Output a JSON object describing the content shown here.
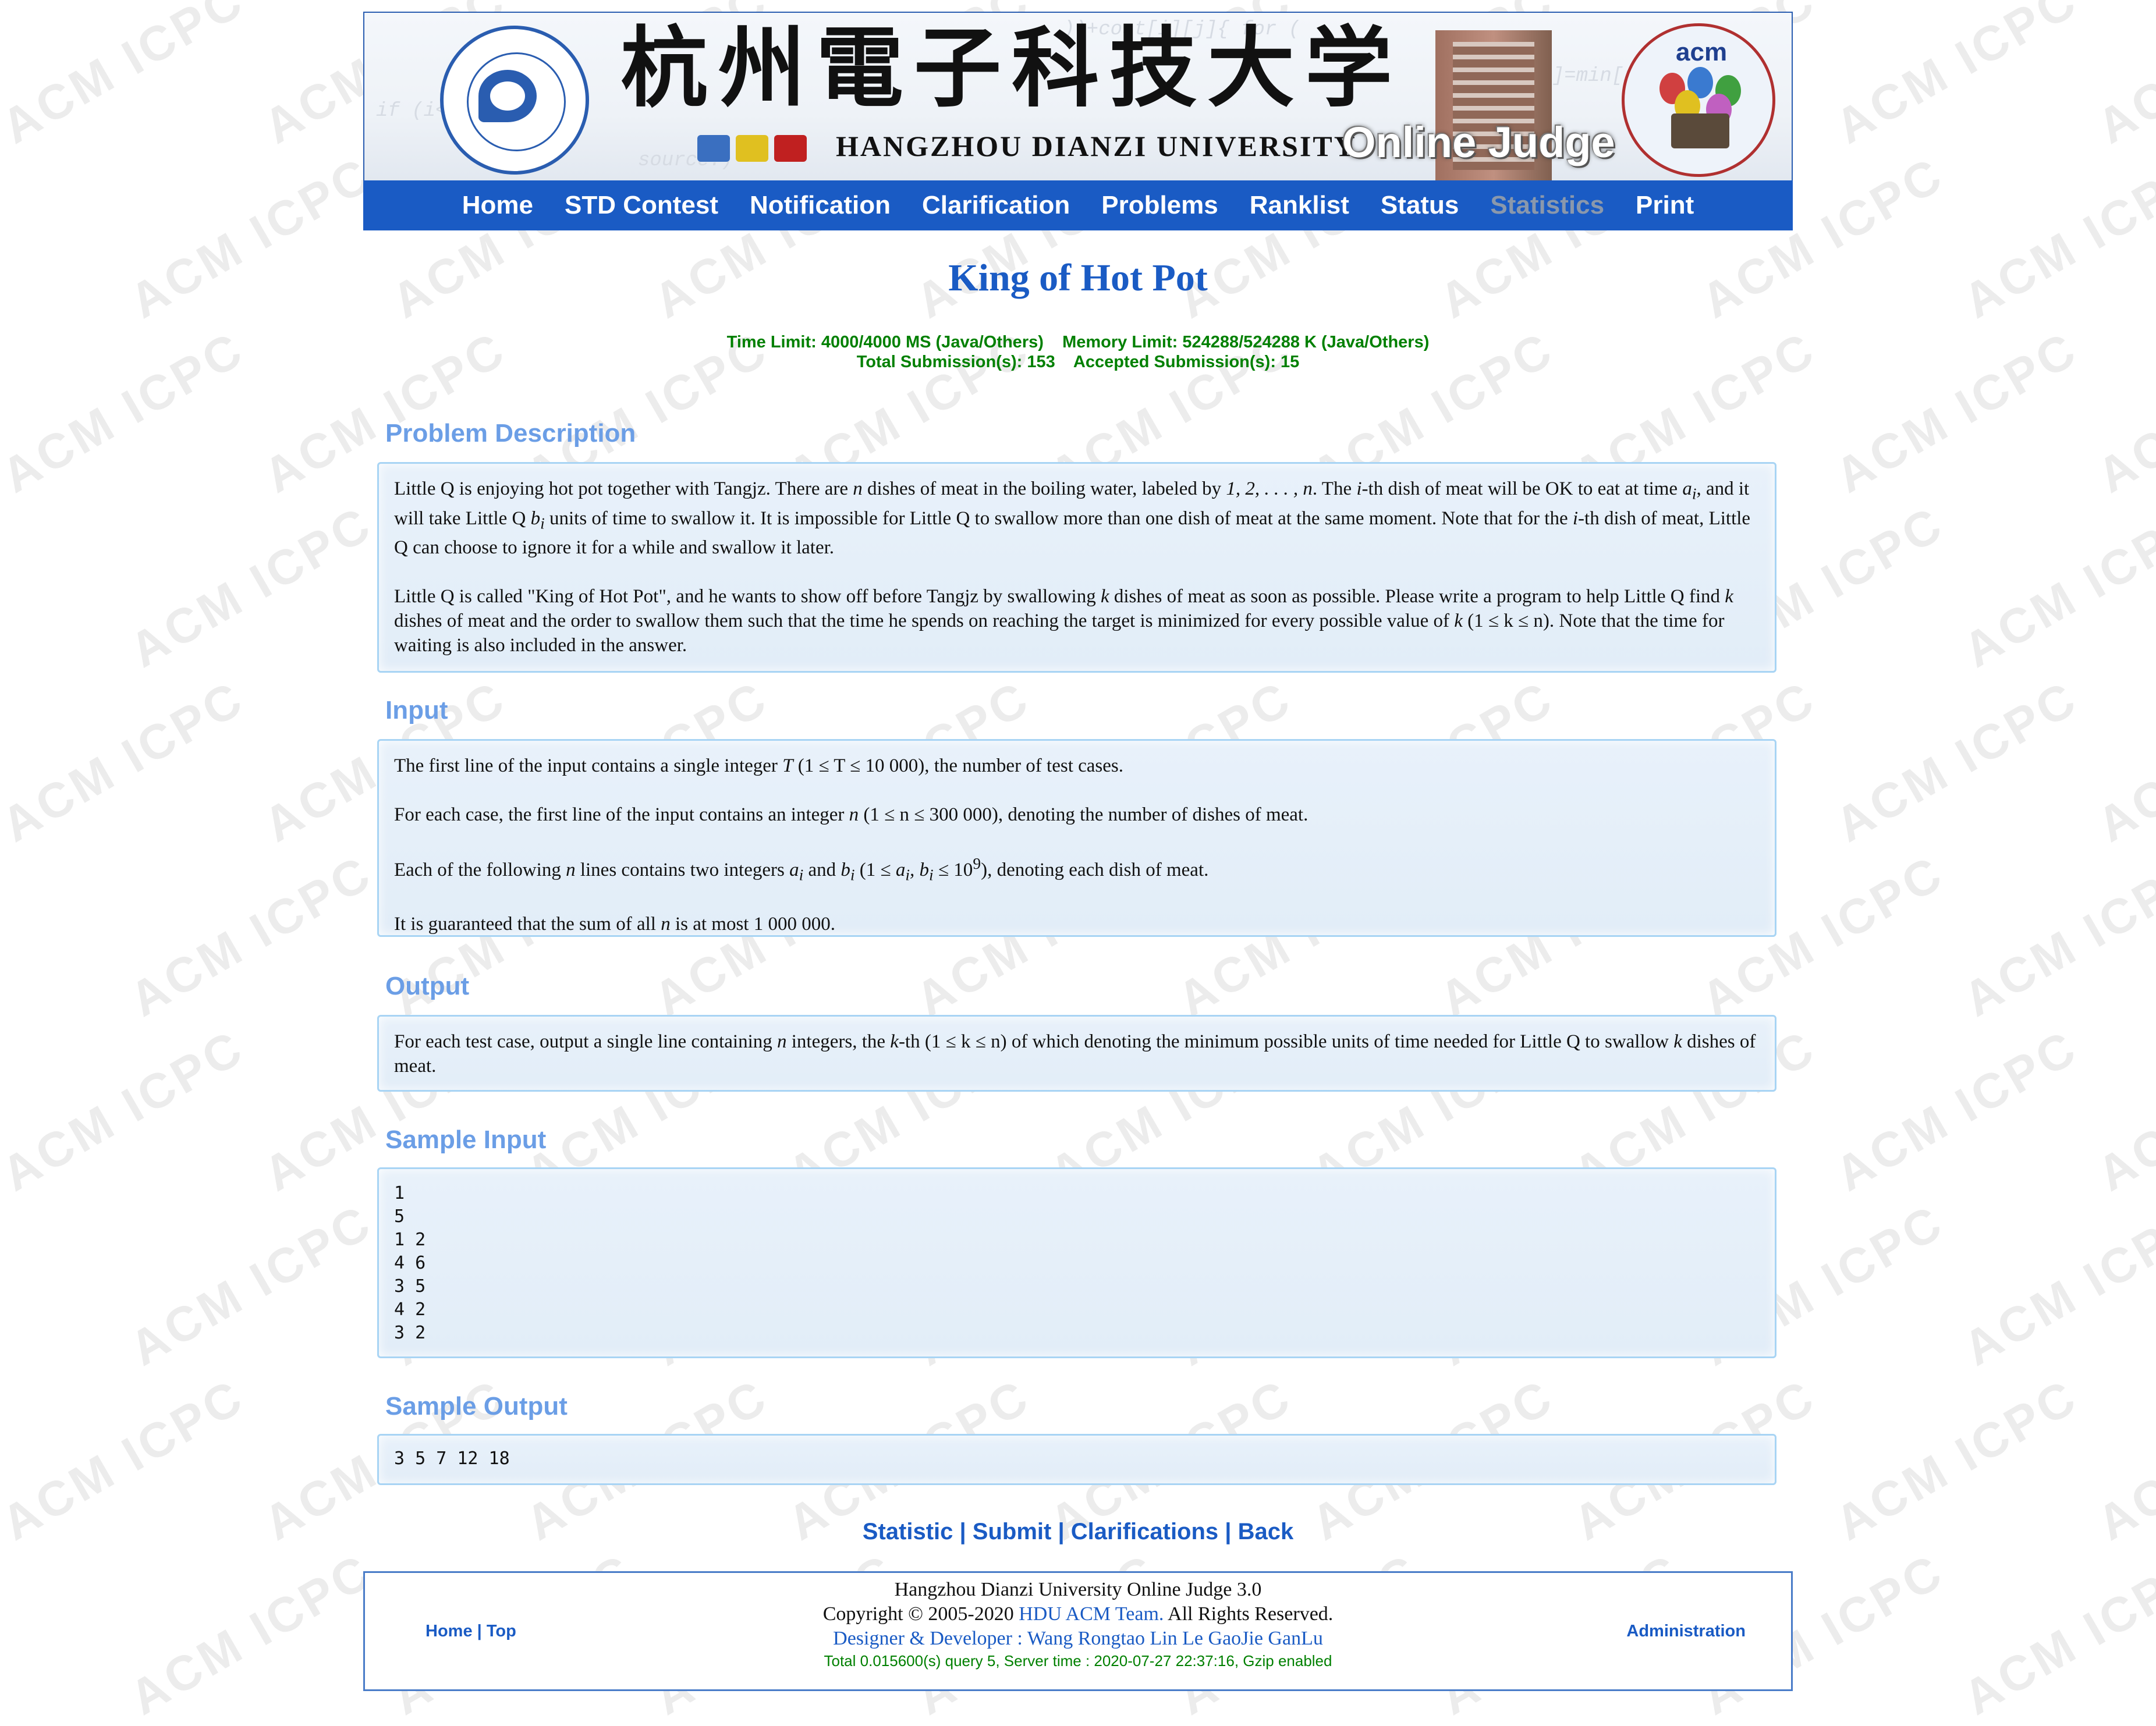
{
  "header": {
    "cn_title": "杭州電子科技大学",
    "university": "HANGZHOU DIANZI UNIVERSITY",
    "oj_label": "Online Judge",
    "acm_logo_text": "acm"
  },
  "nav": {
    "items": [
      "Home",
      "STD Contest",
      "Notification",
      "Clarification",
      "Problems",
      "Ranklist",
      "Status",
      "Statistics",
      "Print"
    ],
    "dimmed": "Statistics"
  },
  "problem": {
    "title": "King of Hot Pot",
    "limits_line": "Time Limit: 4000/4000 MS (Java/Others)    Memory Limit: 524288/524288 K (Java/Others)",
    "submissions_line": "Total Submission(s): 153    Accepted Submission(s): 15"
  },
  "sections": {
    "description_title": "Problem Description",
    "input_title": "Input",
    "output_title": "Output",
    "sample_input_title": "Sample Input",
    "sample_output_title": "Sample Output"
  },
  "description": {
    "p1a": "Little Q is enjoying hot pot together with Tangjz. There are ",
    "p1_n": "n",
    "p1b": " dishes of meat in the boiling water, labeled by ",
    "p1_labels": "1, 2, . . . , n",
    "p1c": ". The ",
    "p1_i": "i",
    "p1d": "-th dish of meat will be OK to eat at time ",
    "p1_ai": "a",
    "p1_ai_sub": "i",
    "p1e": ", and it will take Little Q ",
    "p1_bi": "b",
    "p1_bi_sub": "i",
    "p1f": " units of time to swallow it. It is impossible for Little Q to swallow more than one dish of meat at the same moment. Note that for the ",
    "p1_i2": "i",
    "p1g": "-th dish of meat, Little Q can choose to ignore it for a while and swallow it later.",
    "p2a": "Little Q is called \"King of Hot Pot\", and he wants to show off before Tangjz by swallowing ",
    "p2_k": "k",
    "p2b": " dishes of meat as soon as possible. Please write a program to help Little Q find ",
    "p2_k2": "k",
    "p2c": " dishes of meat and the order to swallow them such that the time he spends on reaching the target is minimized for every possible value of ",
    "p2_k3": "k",
    "p2_range": " (1 ≤ k ≤ n)",
    "p2d": ". Note that the time for waiting is also included in the answer."
  },
  "input": {
    "l1a": "The first line of the input contains a single integer ",
    "l1_T": "T",
    "l1_range": " (1 ≤ T ≤ 10 000)",
    "l1b": ", the number of test cases.",
    "l2a": "For each case, the first line of the input contains an integer ",
    "l2_n": "n",
    "l2_range": " (1 ≤ n ≤ 300 000)",
    "l2b": ", denoting the number of dishes of meat.",
    "l3a": "Each of the following ",
    "l3_n": "n",
    "l3b": " lines contains two integers ",
    "l3_a": "a",
    "l3_a_sub": "i",
    "l3c": " and ",
    "l3_b": "b",
    "l3_b_sub": "i",
    "l3_range_a": " (1 ≤ ",
    "l3_range_b": "a",
    "l3_range_c": "i",
    "l3_range_d": ", b",
    "l3_range_e": "i",
    "l3_range_f": " ≤ 10",
    "l3_range_sup": "9",
    "l3_range_g": ")",
    "l3d": ", denoting each dish of meat.",
    "l4a": "It is guaranteed that the sum of all ",
    "l4_n": "n",
    "l4b": " is at most ",
    "l4_val": "1 000 000",
    "l4c": "."
  },
  "output": {
    "a": "For each test case, output a single line containing ",
    "n": "n",
    "b": " integers, the ",
    "k": "k",
    "c": "-th ",
    "range": "(1 ≤ k ≤ n)",
    "d": " of which denoting the minimum possible units of time needed for Little Q to swallow ",
    "k2": "k",
    "e": " dishes of meat."
  },
  "sample_input": "1\n5\n1 2\n4 6\n3 5\n4 2\n3 2",
  "sample_output": "3 5 7 12 18",
  "bottom_links": {
    "statistic": "Statistic",
    "submit": "Submit",
    "clarifications": "Clarifications",
    "back": "Back",
    "sep": " | "
  },
  "footer": {
    "home": "Home",
    "top": "Top",
    "sep": " | ",
    "line1": "Hangzhou Dianzi University Online Judge 3.0",
    "copyright_a": "Copyright © 2005-2020 ",
    "copyright_team": "HDU ACM Team.",
    "copyright_b": " All Rights Reserved.",
    "designer": "Designer & Developer : Wang Rongtao Lin Le GaoJie GanLu",
    "server": "Total 0.015600(s) query 5, Server time : 2020-07-27 22:37:16, Gzip enabled",
    "admin": "Administration"
  },
  "watermark": "ACM ICPC",
  "colors": {
    "nav_bg": "#1a5bc4",
    "title_blue": "#1a5bc4",
    "section_title": "#6b9ee6",
    "limits_green": "#008000",
    "panel_bg": "#e4eef8"
  }
}
